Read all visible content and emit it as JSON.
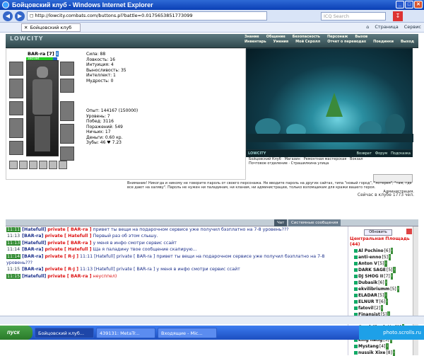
{
  "window": {
    "title": "Бойцовский клуб - Windows Internet Explorer"
  },
  "address": {
    "url": "http://lowcity.combats.com/buttons.pl?battle=0.0175653851773099",
    "search_placeholder": "ICQ Search"
  },
  "tabs": [
    {
      "label": "Бойцовский клуб"
    }
  ],
  "toolbar": {
    "page": "Страница",
    "service": "Сервис"
  },
  "game": {
    "logo": "LOWCITY",
    "menu_row1": [
      "Знание",
      "Общение",
      "Безопасность",
      "Персонаж",
      "Вызов"
    ],
    "menu_row2": [
      "Инвентарь",
      "Умения",
      "Мой Скролл",
      "Отчет о переводах",
      "Поединки",
      "Выход"
    ],
    "character": {
      "name": "BAR-ra",
      "level": "[7]",
      "hp": "384/384"
    },
    "stats": [
      "Сила: 88",
      "Ловкость: 16",
      "Интуиция: 4",
      "Выносливость: 35",
      "Интеллект: 1",
      "Мудрость: 0"
    ],
    "stats2": [
      "Опыт: 144167 (150000)",
      "Уровень: 7",
      "Побед: 3116",
      "Поражений: 549",
      "Ничьих: 17",
      "Деньги: 0.60 кр.",
      "Зубы: 46 ♥ 7.23"
    ],
    "scene_bar": [
      "LOWCITY",
      "Возврат",
      "Форум",
      "Подсказка"
    ],
    "scene_menu": [
      "Бойцовский Клуб",
      "Магазин",
      "Ремонтная мастерская",
      "Вокзал",
      "Почтовое отделение",
      "Страшилкина улица"
    ],
    "warning": "Внимание! Никогда и никому не говорите пароль от своего персонажа. Не вводите пароль на других сайтах, типа \"новый город\", \"лотерея\", \"там, где все дают на халяву\". Пароль не нужен ни паладинам, ни кланам, ни администрации, только взломщикам для кражи вашего героя.",
    "admin": "Администрация.",
    "online": "Сейчас в клубе 1773 чел."
  },
  "chat_tabs": {
    "chat": "Чат",
    "system": "Системные сообщения"
  },
  "chat": [
    {
      "time": "11:11",
      "nick": "[Hatefull]",
      "priv": "private [ BAR-ra ]",
      "msg": "привет ты вещи на подарочном сервисе уже получил бэзплатно на 7-8 уровень???",
      "red": false
    },
    {
      "time": "11:13",
      "nick": "[BAR-ra]",
      "priv": "private [ Hatefull ]",
      "msg": "Первый раз об этом слышу.",
      "red": false
    },
    {
      "time": "11:13",
      "nick": "[Hatefull]",
      "priv": "private [ BAR-ra ]",
      "msg": "у меня в инфо смотри сервис ссайт",
      "red": false
    },
    {
      "time": "11:14",
      "nick": "[BAR-ra]",
      "priv": "private [ Hatefull ]",
      "msg": "Ща я паладину твое сообщение скапирую...",
      "red": false
    },
    {
      "time": "11:14",
      "nick": "[BAR-ra]",
      "priv": "private [ R-J ]",
      "msg": "11:11 [Hatefull] private [ BAR-ra ] привет ты вещи на подарочном сервисе уже получил бэзплатно на 7-8 уровень???",
      "red": false
    },
    {
      "time": "11:15",
      "nick": "[BAR-ra]",
      "priv": "private [ R-J ]",
      "msg": "11:13 [Hatefull] private [ BAR-ra ] у меня в инфо смотри сервис ссайт",
      "red": false
    },
    {
      "time": "11:15",
      "nick": "[Hatefull]",
      "priv": "private [ BAR-ra ]",
      "msg": "неусппел)",
      "red": true
    }
  ],
  "sidebar": {
    "refresh": "Обновить",
    "room": "Центральная Площадь (44)",
    "players": [
      {
        "name": "Al Pochino",
        "level": "[6]"
      },
      {
        "name": "anti-enno",
        "level": "[5]"
      },
      {
        "name": "Anton V",
        "level": "[5]"
      },
      {
        "name": "DARK SAGE",
        "level": "[5]"
      },
      {
        "name": "DJ SHOG II",
        "level": "[7]"
      },
      {
        "name": "Dubasik",
        "level": "[6]"
      },
      {
        "name": "ekvilibriumm",
        "level": "[5]"
      },
      {
        "name": "ELADAR",
        "level": "[5]"
      },
      {
        "name": "ELNUR T",
        "level": "[6]"
      },
      {
        "name": "fatovil",
        "level": "[2]"
      },
      {
        "name": "Finansist",
        "level": "[5]"
      },
      {
        "name": "fzn",
        "level": "[5]"
      },
      {
        "name": "Good Charlotte",
        "level": "[2]"
      },
      {
        "name": "KAM-RAN-GS",
        "level": "[4]"
      },
      {
        "name": "king natig",
        "level": "[5]"
      },
      {
        "name": "Mystang",
        "level": "[4]"
      },
      {
        "name": "nussik Xixe",
        "level": "[8]"
      }
    ]
  },
  "taskbar": {
    "start": "пуск",
    "items": [
      "Бойцовский клуб...",
      "439131: MetaTr...",
      "Входящие - Mic..."
    ],
    "tray": "photo.scrolls.ru"
  },
  "colors": {
    "accent": "#2f6bd6",
    "private": "#dd1111",
    "nick": "#1a2e8a"
  }
}
